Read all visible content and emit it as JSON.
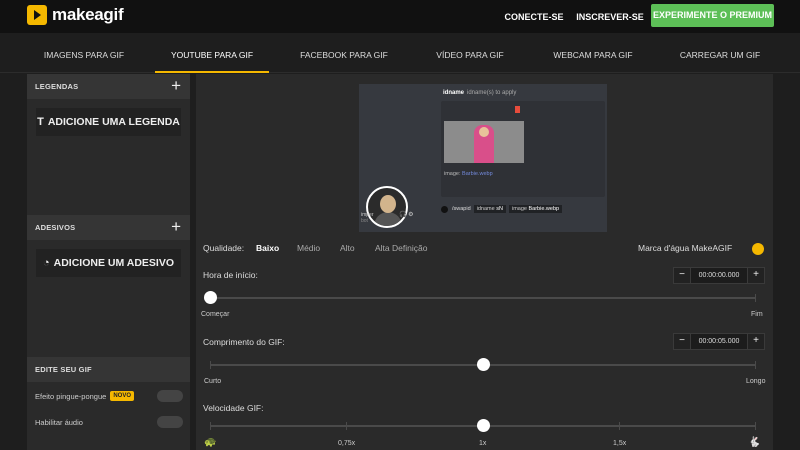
{
  "header": {
    "logo_text": "makeagif",
    "login_label": "CONECTE-SE",
    "signup_label": "INSCREVER-SE",
    "premium_label": "EXPERIMENTE O PREMIUM",
    "accent_color": "#f5b800",
    "premium_color": "#5dbf57"
  },
  "tabs": [
    {
      "label": "IMAGENS PARA GIF",
      "active": false
    },
    {
      "label": "YOUTUBE PARA GIF",
      "active": true
    },
    {
      "label": "FACEBOOK PARA GIF",
      "active": false
    },
    {
      "label": "VÍDEO PARA GIF",
      "active": false
    },
    {
      "label": "WEBCAM PARA GIF",
      "active": false
    },
    {
      "label": "CARREGAR UM GIF",
      "active": false
    }
  ],
  "sidebar": {
    "captions": {
      "title": "LEGENDAS",
      "add_label": "ADICIONE UMA LEGENDA",
      "icon": "text-icon"
    },
    "stickers": {
      "title": "ADESIVOS",
      "add_label": "ADICIONE UM ADESIVO",
      "icon": "sticker-icon"
    },
    "edit": {
      "title": "EDITE SEU GIF",
      "pingpong_label": "Efeito pingue-pongue",
      "pingpong_badge": "NOVO",
      "pingpong_enabled": false,
      "audio_label": "Habilitar áudio",
      "audio_enabled": false
    }
  },
  "preview": {
    "cmd_name": "idname",
    "cmd_hint": "idname(s) to apply",
    "image_caption": "image:",
    "image_file": "Barbie.webp",
    "user_name": "imper",
    "user_sub": "bot",
    "command": "/swapid",
    "chip1_key": "idname",
    "chip1_val": "sN",
    "chip2_key": "image",
    "chip2_val": "Barbie.webp"
  },
  "quality": {
    "label": "Qualidade:",
    "options": [
      "Baixo",
      "Médio",
      "Alto",
      "Alta Definição"
    ],
    "selected": "Baixo"
  },
  "watermark": {
    "label": "Marca d'água MakeAGIF",
    "enabled": true
  },
  "start_time": {
    "label": "Hora de início:",
    "value": "00:00:00.000",
    "min_label": "Começar",
    "max_label": "Fim",
    "level": 0.0
  },
  "gif_length": {
    "label": "Comprimento do GIF:",
    "value": "00:00:05.000",
    "min_label": "Curto",
    "max_label": "Longo",
    "level": 0.5
  },
  "gif_speed": {
    "label": "Velocidade GIF:",
    "marks": [
      "0,75x",
      "1x",
      "1,5x"
    ],
    "slow_icon": "turtle-icon",
    "fast_icon": "rabbit-icon",
    "level": 0.5
  },
  "stepper": {
    "minus": "−",
    "plus": "+"
  }
}
